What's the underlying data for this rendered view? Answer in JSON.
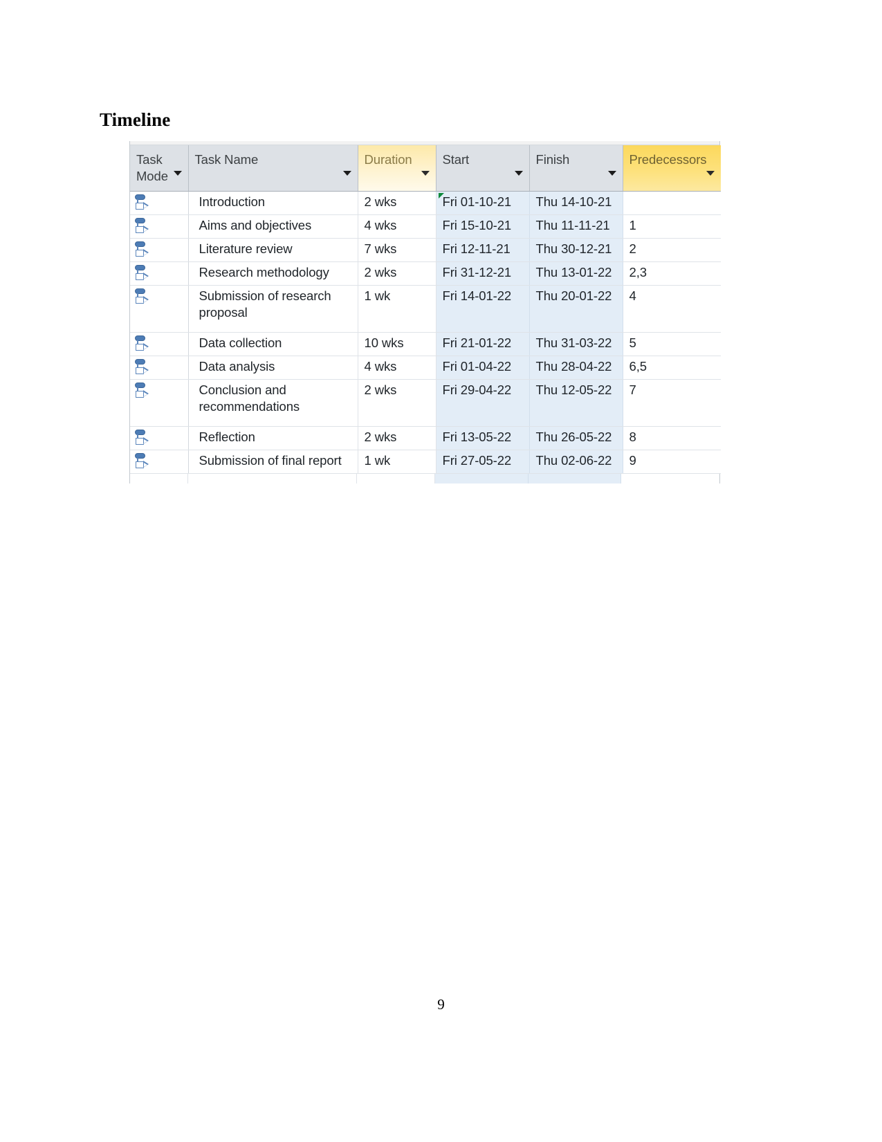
{
  "document": {
    "heading": "Timeline",
    "page_number": "9"
  },
  "project_table": {
    "columns": [
      {
        "key": "task_mode",
        "label": "Task Mode",
        "highlight": "none"
      },
      {
        "key": "task_name",
        "label": "Task Name",
        "highlight": "none"
      },
      {
        "key": "duration",
        "label": "Duration",
        "highlight": "light-yellow"
      },
      {
        "key": "start",
        "label": "Start",
        "highlight": "none"
      },
      {
        "key": "finish",
        "label": "Finish",
        "highlight": "none"
      },
      {
        "key": "predecessors",
        "label": "Predecessors",
        "highlight": "gold"
      }
    ],
    "colors": {
      "header_bg": "#dde1e6",
      "duration_header_bg": "#fde9a9",
      "predecessors_header_bg": "#fcd85c",
      "date_cell_bg": "#e3edf7",
      "grid_line": "#dfe3e8",
      "task_mode_icon": "#4d7cb5",
      "constraint_flag": "#0f8a3c"
    },
    "task_mode_icon_name": "auto-scheduled-icon",
    "rows": [
      {
        "task_mode": "Auto Scheduled",
        "task_name": "Introduction",
        "duration": "2 wks",
        "start": "Fri 01-10-21",
        "finish": "Thu 14-10-21",
        "predecessors": "",
        "has_constraint_flag": true
      },
      {
        "task_mode": "Auto Scheduled",
        "task_name": "Aims and objectives",
        "duration": "4 wks",
        "start": "Fri 15-10-21",
        "finish": "Thu 11-11-21",
        "predecessors": "1",
        "has_constraint_flag": false
      },
      {
        "task_mode": "Auto Scheduled",
        "task_name": "Literature review",
        "duration": "7 wks",
        "start": "Fri 12-11-21",
        "finish": "Thu 30-12-21",
        "predecessors": "2",
        "has_constraint_flag": false
      },
      {
        "task_mode": "Auto Scheduled",
        "task_name": "Research methodology",
        "duration": "2 wks",
        "start": "Fri 31-12-21",
        "finish": "Thu 13-01-22",
        "predecessors": "2,3",
        "has_constraint_flag": false
      },
      {
        "task_mode": "Auto Scheduled",
        "task_name": "Submission of research proposal",
        "duration": "1 wk",
        "start": "Fri 14-01-22",
        "finish": "Thu 20-01-22",
        "predecessors": "4",
        "has_constraint_flag": false,
        "tall": true
      },
      {
        "task_mode": "Auto Scheduled",
        "task_name": "Data collection",
        "duration": "10 wks",
        "start": "Fri 21-01-22",
        "finish": "Thu 31-03-22",
        "predecessors": "5",
        "has_constraint_flag": false
      },
      {
        "task_mode": "Auto Scheduled",
        "task_name": "Data analysis",
        "duration": "4 wks",
        "start": "Fri 01-04-22",
        "finish": "Thu 28-04-22",
        "predecessors": "6,5",
        "has_constraint_flag": false
      },
      {
        "task_mode": "Auto Scheduled",
        "task_name": "Conclusion and recommendations",
        "duration": "2 wks",
        "start": "Fri 29-04-22",
        "finish": "Thu 12-05-22",
        "predecessors": "7",
        "has_constraint_flag": false,
        "tall": true
      },
      {
        "task_mode": "Auto Scheduled",
        "task_name": "Reflection",
        "duration": "2 wks",
        "start": "Fri 13-05-22",
        "finish": "Thu 26-05-22",
        "predecessors": "8",
        "has_constraint_flag": false
      },
      {
        "task_mode": "Auto Scheduled",
        "task_name": "Submission of final report",
        "duration": "1 wk",
        "start": "Fri 27-05-22",
        "finish": "Thu 02-06-22",
        "predecessors": "9",
        "has_constraint_flag": false
      }
    ]
  }
}
